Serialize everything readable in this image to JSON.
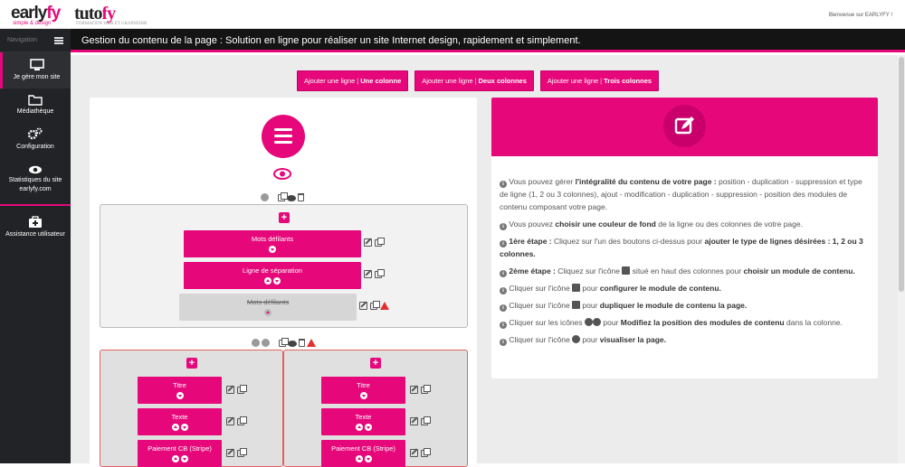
{
  "brand": {
    "logo1_main": "early",
    "logo1_accent": "fy",
    "logo1_tagline": "simple & design",
    "logo2_main": "tuto",
    "logo2_accent": "fy",
    "logo2_tagline": "FORMATION WEB ET GRAPHISME"
  },
  "header": {
    "welcome": "Bienvenue sur EARLYFY !",
    "title": "Gestion du contenu de la page : Solution en ligne pour réaliser un site Internet design, rapidement et simplement."
  },
  "sidebar": {
    "nav_label": "Navigation",
    "items": [
      {
        "label": "Je gère mon site",
        "icon": "monitor-icon"
      },
      {
        "label": "Médiathèque",
        "icon": "folder-icon"
      },
      {
        "label": "Configuration",
        "icon": "gears-icon"
      },
      {
        "label": "Statistiques du site earlyfy.com",
        "icon": "eye-icon"
      },
      {
        "label": "Assistance utilisateur",
        "icon": "medkit-icon"
      }
    ]
  },
  "toolbar": {
    "prefix": "Ajouter une ligne",
    "sep": "|",
    "buttons": [
      "Une colonne",
      "Deux colonnes",
      "Trois colonnes"
    ]
  },
  "editor": {
    "row1_modules": [
      "Mots défilants",
      "Ligne de séparation",
      "Mots défilants"
    ],
    "row2_col1": [
      "Titre",
      "Texte",
      "Paiement CB (Stripe)"
    ],
    "row2_col2": [
      "Titre",
      "Texte",
      "Paiement CB (Stripe)"
    ]
  },
  "help": {
    "p1_a": "Vous pouvez gérer ",
    "p1_b": "l'intégralité du contenu de votre page :",
    "p1_c": " position - duplication - suppression et type de ligne (1, 2 ou 3 colonnes), ajout - modification - duplication - suppression - position des modules de contenu composant votre page.",
    "p2_a": "Vous pouvez ",
    "p2_b": "choisir une couleur de fond",
    "p2_c": " de la ligne ou des colonnes de votre page.",
    "p3_a": "1ère étape :",
    "p3_b": " Cliquez sur l'un des boutons ci-dessus pour ",
    "p3_c": "ajouter le type de lignes désirées : 1, 2 ou 3 colonnes.",
    "p4_a": "2ème étape :",
    "p4_b": " Cliquez sur l'icône ",
    "p4_c": " situé en haut des colonnes pour ",
    "p4_d": "choisir un module de contenu.",
    "p5_a": "Cliquer sur l'icône ",
    "p5_b": " pour ",
    "p5_c": "configurer le module de contenu.",
    "p6_a": "Cliquer sur l'icône ",
    "p6_b": " pour ",
    "p6_c": "dupliquer le module de contenu la page.",
    "p7_a": "Cliquer sur les icônes ",
    "p7_b": " pour ",
    "p7_c": "Modifiez la position des modules de contenu",
    "p7_d": " dans la colonne.",
    "p8_a": "Cliquer sur l'icône ",
    "p8_b": " pour ",
    "p8_c": "visualiser la page."
  },
  "colors": {
    "accent": "#e6087a",
    "sidebar": "#222326",
    "titlebar": "#141414"
  }
}
